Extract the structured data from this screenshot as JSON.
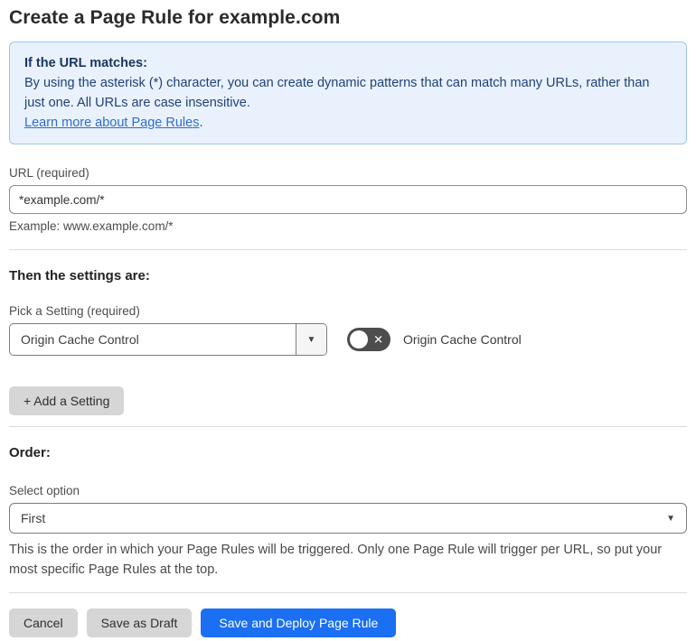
{
  "page": {
    "title": "Create a Page Rule for example.com"
  },
  "info_box": {
    "heading": "If the URL matches:",
    "body": "By using the asterisk (*) character, you can create dynamic patterns that can match many URLs, rather than just one. All URLs are case insensitive.",
    "link_label": "Learn more about Page Rules",
    "link_suffix": "."
  },
  "url_field": {
    "label": "URL (required)",
    "value": "*example.com/*",
    "helper": "Example: www.example.com/*"
  },
  "settings_section": {
    "heading": "Then the settings are:",
    "picker_label": "Pick a Setting (required)",
    "picker_value": "Origin Cache Control",
    "picker_caret": "▼",
    "toggle_state": "off",
    "toggle_x_glyph": "✕",
    "toggle_label": "Origin Cache Control",
    "add_setting_button": "+ Add a Setting"
  },
  "order_section": {
    "heading": "Order:",
    "select_label": "Select option",
    "select_value": "First",
    "select_caret": "▼",
    "helper": "This is the order in which your Page Rules will be triggered. Only one Page Rule will trigger per URL, so put your most specific Page Rules at the top."
  },
  "footer": {
    "cancel_label": "Cancel",
    "save_draft_label": "Save as Draft",
    "save_deploy_label": "Save and Deploy Page Rule"
  },
  "colors": {
    "accent_blue": "#1a6ff2",
    "info_background": "#e9f2fc",
    "info_border": "#9ec6ec",
    "info_text": "#1e3a6b",
    "link_blue": "#2f6cd0",
    "toggle_off_background": "#4d4d4d",
    "button_gray": "#d6d6d6"
  }
}
